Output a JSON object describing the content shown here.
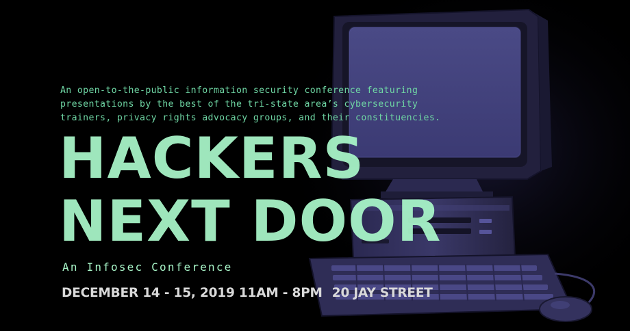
{
  "banner": {
    "intro": "An open-to-the-public information security conference featuring presentations by the best of the tri-state area’s cybersecurity trainers, privacy rights advocacy groups, and their constituencies.",
    "title_line1": "HACKERS",
    "title_line2": "NEXT DOOR",
    "subtitle": "An Infosec Conference",
    "dates_time": "DECEMBER 14 - 15, 2019 11AM - 8PM",
    "location": "20 JAY STREET"
  },
  "colors": {
    "background": "#000000",
    "accent_green": "#a8f5c8",
    "intro_green": "#6fd6a4",
    "detail_gray": "#d9d9d9",
    "computer_tint": "#2c2a50"
  },
  "illustration": {
    "subject": "retro-desktop-computer"
  }
}
